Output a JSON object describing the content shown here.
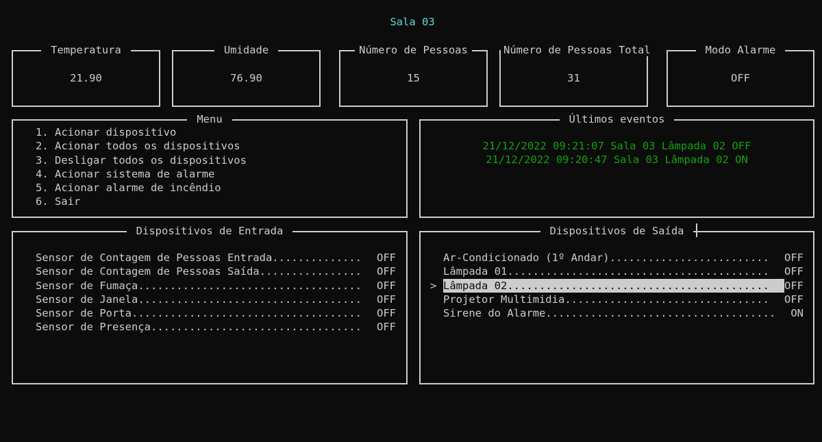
{
  "title": "Sala 03",
  "stats": {
    "temperatura": {
      "label": "Temperatura",
      "value": "21.90"
    },
    "umidade": {
      "label": "Umidade",
      "value": "76.90"
    },
    "pessoas": {
      "label": "Número de Pessoas",
      "value": "15"
    },
    "pessoas_total": {
      "label": "Número de Pessoas Total",
      "value": "31"
    },
    "alarme": {
      "label": "Modo Alarme",
      "value": "OFF"
    }
  },
  "menu": {
    "label": "Menu",
    "items": [
      "1. Acionar dispositivo",
      "2. Acionar todos os dispositivos",
      "3. Desligar todos os dispositivos",
      "4. Acionar sistema de alarme",
      "5. Acionar alarme de incêndio",
      "6. Sair"
    ]
  },
  "events": {
    "label": "Últimos eventos",
    "items": [
      "21/12/2022 09:21:07 Sala 03 Lâmpada 02 OFF",
      "21/12/2022 09:20:47 Sala 03 Lâmpada 02 ON"
    ]
  },
  "inputs": {
    "label": "Dispositivos de Entrada",
    "items": [
      {
        "name": "Sensor de Contagem de Pessoas Entrada",
        "dots": "..............",
        "state": "OFF"
      },
      {
        "name": "Sensor de Contagem de Pessoas Saída",
        "dots": "................",
        "state": "OFF"
      },
      {
        "name": "Sensor de Fumaça",
        "dots": "...................................",
        "state": "OFF"
      },
      {
        "name": "Sensor de Janela",
        "dots": "...................................",
        "state": "OFF"
      },
      {
        "name": "Sensor de Porta",
        "dots": "....................................",
        "state": "OFF"
      },
      {
        "name": "Sensor de Presença",
        "dots": ".................................",
        "state": "OFF"
      }
    ]
  },
  "outputs": {
    "label": "Dispositivos de Saída",
    "cursor": ">",
    "items": [
      {
        "name": "Ar-Condicionado (1º Andar)",
        "dots": ".........................",
        "state": "OFF"
      },
      {
        "name": "Lâmpada 01",
        "dots": ".........................................",
        "state": "OFF"
      },
      {
        "name": "Lâmpada 02",
        "dots": ".........................................",
        "state": "OFF"
      },
      {
        "name": "Projetor Multimidia",
        "dots": "................................",
        "state": "OFF"
      },
      {
        "name": "Sirene do Alarme",
        "dots": "....................................",
        "state": "ON"
      }
    ]
  }
}
